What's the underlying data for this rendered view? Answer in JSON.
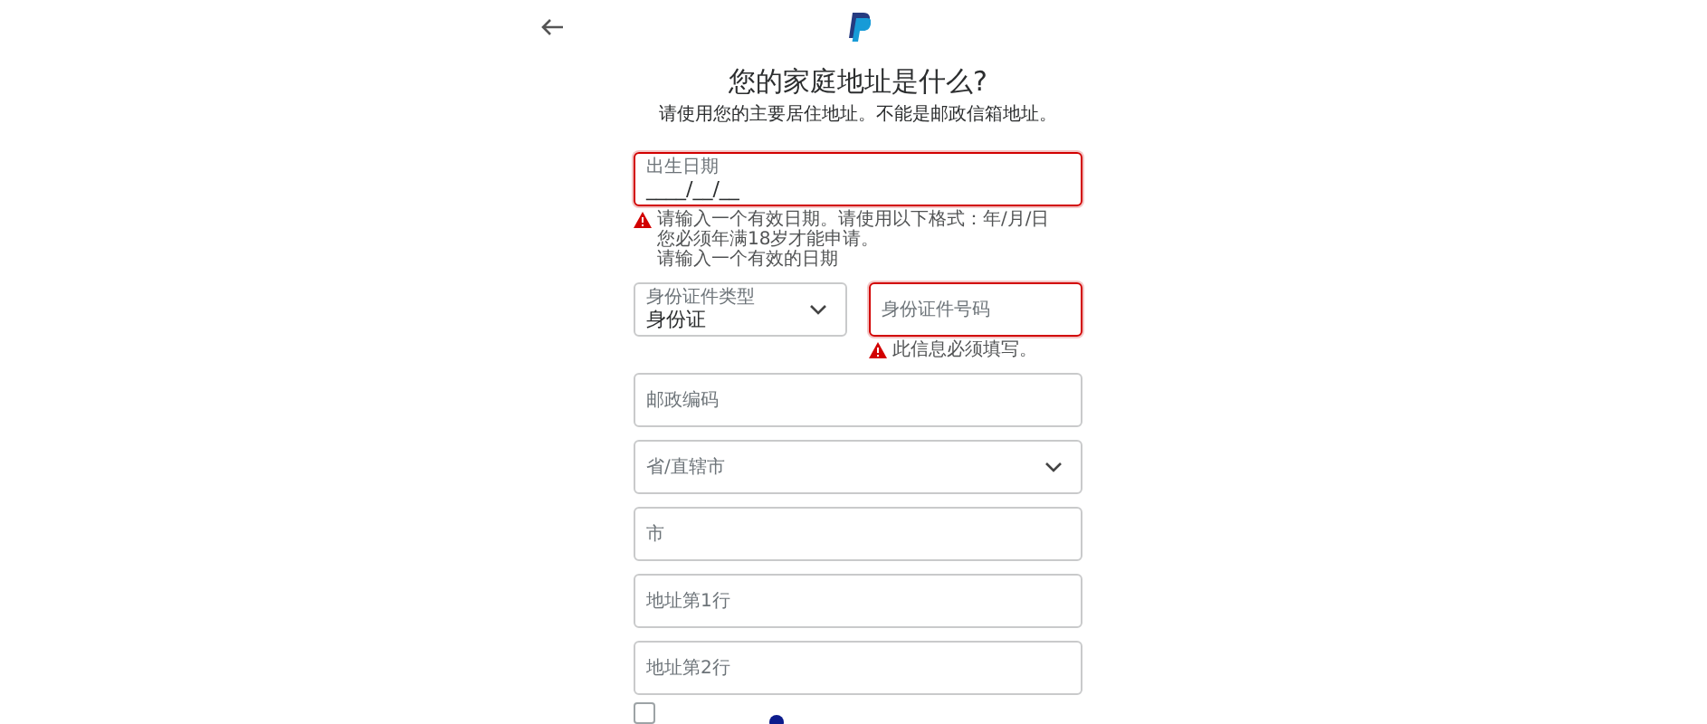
{
  "header": {
    "title": "您的家庭地址是什么?",
    "subtitle": "请使用您的主要居住地址。不能是邮政信箱地址。"
  },
  "rows": [
    {
      "fields": [
        {
          "kind": "text",
          "label": "出生日期",
          "value": "____/__/__",
          "invalid": true,
          "errors": [
            "请输入一个有效日期。请使用以下格式：年/月/日",
            "您必须年满18岁才能申请。",
            "请输入一个有效的日期"
          ]
        }
      ]
    },
    {
      "fields": [
        {
          "kind": "select",
          "label": "身份证件类型",
          "value": "身份证",
          "invalid": false
        },
        {
          "kind": "text",
          "placeholder": "身份证件号码",
          "invalid": true,
          "errors": [
            "此信息必须填写。"
          ]
        }
      ]
    },
    {
      "fields": [
        {
          "kind": "text",
          "placeholder": "邮政编码",
          "invalid": false
        }
      ]
    },
    {
      "fields": [
        {
          "kind": "select",
          "placeholder": "省/直辖市",
          "invalid": false
        }
      ]
    },
    {
      "fields": [
        {
          "kind": "text",
          "placeholder": "市",
          "invalid": false
        }
      ]
    },
    {
      "fields": [
        {
          "kind": "text",
          "placeholder": "地址第1行",
          "invalid": false
        }
      ]
    },
    {
      "fields": [
        {
          "kind": "text",
          "placeholder": "地址第2行",
          "invalid": false
        }
      ]
    }
  ],
  "option": {
    "checked": false
  }
}
